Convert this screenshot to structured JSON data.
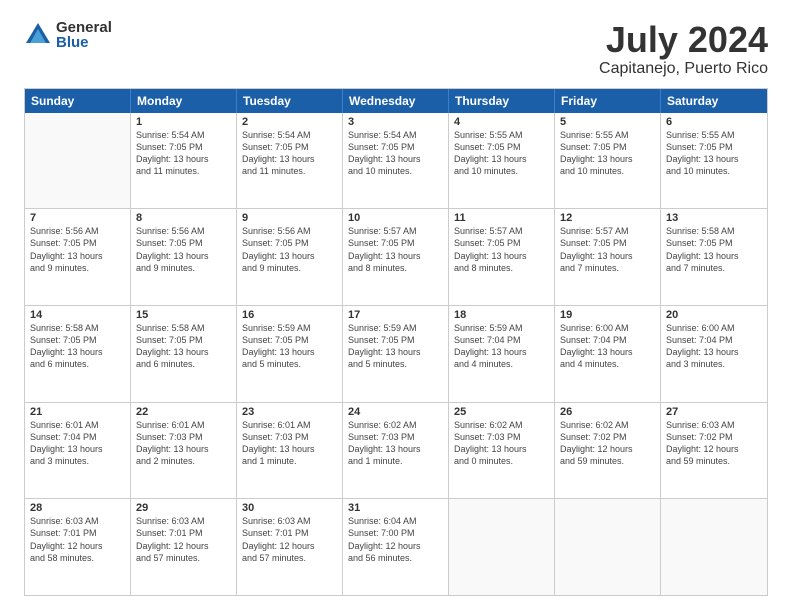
{
  "logo": {
    "general": "General",
    "blue": "Blue"
  },
  "title": "July 2024",
  "subtitle": "Capitanejo, Puerto Rico",
  "header_days": [
    "Sunday",
    "Monday",
    "Tuesday",
    "Wednesday",
    "Thursday",
    "Friday",
    "Saturday"
  ],
  "weeks": [
    [
      {
        "day": "",
        "info": ""
      },
      {
        "day": "1",
        "info": "Sunrise: 5:54 AM\nSunset: 7:05 PM\nDaylight: 13 hours\nand 11 minutes."
      },
      {
        "day": "2",
        "info": "Sunrise: 5:54 AM\nSunset: 7:05 PM\nDaylight: 13 hours\nand 11 minutes."
      },
      {
        "day": "3",
        "info": "Sunrise: 5:54 AM\nSunset: 7:05 PM\nDaylight: 13 hours\nand 10 minutes."
      },
      {
        "day": "4",
        "info": "Sunrise: 5:55 AM\nSunset: 7:05 PM\nDaylight: 13 hours\nand 10 minutes."
      },
      {
        "day": "5",
        "info": "Sunrise: 5:55 AM\nSunset: 7:05 PM\nDaylight: 13 hours\nand 10 minutes."
      },
      {
        "day": "6",
        "info": "Sunrise: 5:55 AM\nSunset: 7:05 PM\nDaylight: 13 hours\nand 10 minutes."
      }
    ],
    [
      {
        "day": "7",
        "info": "Sunrise: 5:56 AM\nSunset: 7:05 PM\nDaylight: 13 hours\nand 9 minutes."
      },
      {
        "day": "8",
        "info": "Sunrise: 5:56 AM\nSunset: 7:05 PM\nDaylight: 13 hours\nand 9 minutes."
      },
      {
        "day": "9",
        "info": "Sunrise: 5:56 AM\nSunset: 7:05 PM\nDaylight: 13 hours\nand 9 minutes."
      },
      {
        "day": "10",
        "info": "Sunrise: 5:57 AM\nSunset: 7:05 PM\nDaylight: 13 hours\nand 8 minutes."
      },
      {
        "day": "11",
        "info": "Sunrise: 5:57 AM\nSunset: 7:05 PM\nDaylight: 13 hours\nand 8 minutes."
      },
      {
        "day": "12",
        "info": "Sunrise: 5:57 AM\nSunset: 7:05 PM\nDaylight: 13 hours\nand 7 minutes."
      },
      {
        "day": "13",
        "info": "Sunrise: 5:58 AM\nSunset: 7:05 PM\nDaylight: 13 hours\nand 7 minutes."
      }
    ],
    [
      {
        "day": "14",
        "info": "Sunrise: 5:58 AM\nSunset: 7:05 PM\nDaylight: 13 hours\nand 6 minutes."
      },
      {
        "day": "15",
        "info": "Sunrise: 5:58 AM\nSunset: 7:05 PM\nDaylight: 13 hours\nand 6 minutes."
      },
      {
        "day": "16",
        "info": "Sunrise: 5:59 AM\nSunset: 7:05 PM\nDaylight: 13 hours\nand 5 minutes."
      },
      {
        "day": "17",
        "info": "Sunrise: 5:59 AM\nSunset: 7:05 PM\nDaylight: 13 hours\nand 5 minutes."
      },
      {
        "day": "18",
        "info": "Sunrise: 5:59 AM\nSunset: 7:04 PM\nDaylight: 13 hours\nand 4 minutes."
      },
      {
        "day": "19",
        "info": "Sunrise: 6:00 AM\nSunset: 7:04 PM\nDaylight: 13 hours\nand 4 minutes."
      },
      {
        "day": "20",
        "info": "Sunrise: 6:00 AM\nSunset: 7:04 PM\nDaylight: 13 hours\nand 3 minutes."
      }
    ],
    [
      {
        "day": "21",
        "info": "Sunrise: 6:01 AM\nSunset: 7:04 PM\nDaylight: 13 hours\nand 3 minutes."
      },
      {
        "day": "22",
        "info": "Sunrise: 6:01 AM\nSunset: 7:03 PM\nDaylight: 13 hours\nand 2 minutes."
      },
      {
        "day": "23",
        "info": "Sunrise: 6:01 AM\nSunset: 7:03 PM\nDaylight: 13 hours\nand 1 minute."
      },
      {
        "day": "24",
        "info": "Sunrise: 6:02 AM\nSunset: 7:03 PM\nDaylight: 13 hours\nand 1 minute."
      },
      {
        "day": "25",
        "info": "Sunrise: 6:02 AM\nSunset: 7:03 PM\nDaylight: 13 hours\nand 0 minutes."
      },
      {
        "day": "26",
        "info": "Sunrise: 6:02 AM\nSunset: 7:02 PM\nDaylight: 12 hours\nand 59 minutes."
      },
      {
        "day": "27",
        "info": "Sunrise: 6:03 AM\nSunset: 7:02 PM\nDaylight: 12 hours\nand 59 minutes."
      }
    ],
    [
      {
        "day": "28",
        "info": "Sunrise: 6:03 AM\nSunset: 7:01 PM\nDaylight: 12 hours\nand 58 minutes."
      },
      {
        "day": "29",
        "info": "Sunrise: 6:03 AM\nSunset: 7:01 PM\nDaylight: 12 hours\nand 57 minutes."
      },
      {
        "day": "30",
        "info": "Sunrise: 6:03 AM\nSunset: 7:01 PM\nDaylight: 12 hours\nand 57 minutes."
      },
      {
        "day": "31",
        "info": "Sunrise: 6:04 AM\nSunset: 7:00 PM\nDaylight: 12 hours\nand 56 minutes."
      },
      {
        "day": "",
        "info": ""
      },
      {
        "day": "",
        "info": ""
      },
      {
        "day": "",
        "info": ""
      }
    ]
  ]
}
